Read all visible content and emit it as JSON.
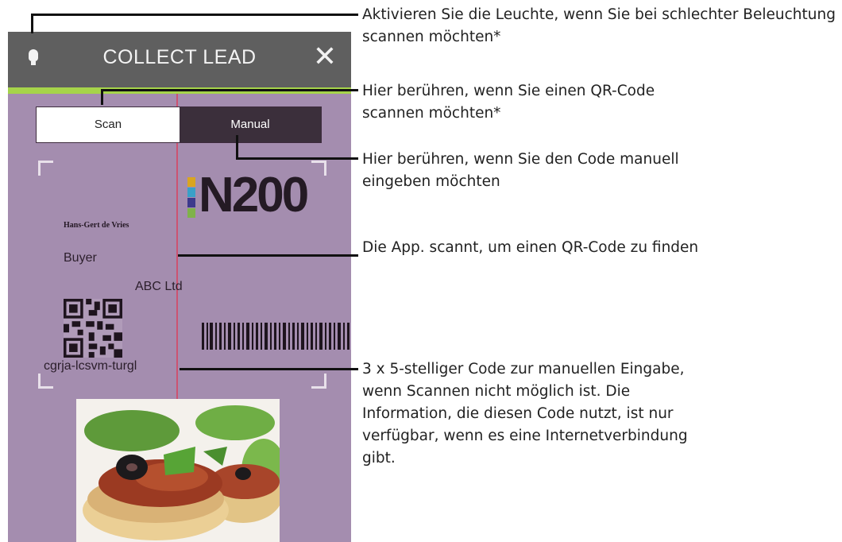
{
  "app": {
    "title": "COLLECT LEAD",
    "close_label": "✕",
    "tabs": [
      {
        "label": "Scan",
        "selected": true
      },
      {
        "label": "Manual",
        "selected": false
      }
    ]
  },
  "badge": {
    "logo_text": "N200",
    "name": "Hans-Gert de Vries",
    "role": "Buyer",
    "company": "ABC Ltd",
    "code": "cgrja-lcsvm-turgl"
  },
  "annotations": [
    {
      "text": "Aktivieren Sie die Leuchte, wenn Sie bei schlechter Beleuchtung scannen möchten*"
    },
    {
      "text": "Hier berühren, wenn Sie einen QR-Code scannen möchten*"
    },
    {
      "text": "Hier berühren, wenn Sie den Code manuell eingeben möchten"
    },
    {
      "text": "Die App. scannt, um einen QR-Code zu finden"
    },
    {
      "text": "3 x 5-stelliger Code zur manuellen Eingabe, wenn Scannen nicht möglich ist. Die Information, die diesen Code nutzt, ist nur verfügbar, wenn es eine Internetverbindung gibt."
    }
  ],
  "icons": {
    "light": "lightbulb-icon",
    "close": "close-icon",
    "qr": "qr-code-icon",
    "barcode": "barcode-icon"
  },
  "colors": {
    "topbar": "#5f5f5f",
    "accent_green": "#a6d44a",
    "background_purple": "#a48daf",
    "segment_dark": "#3b2f3b",
    "scanline": "#d04c6a"
  }
}
